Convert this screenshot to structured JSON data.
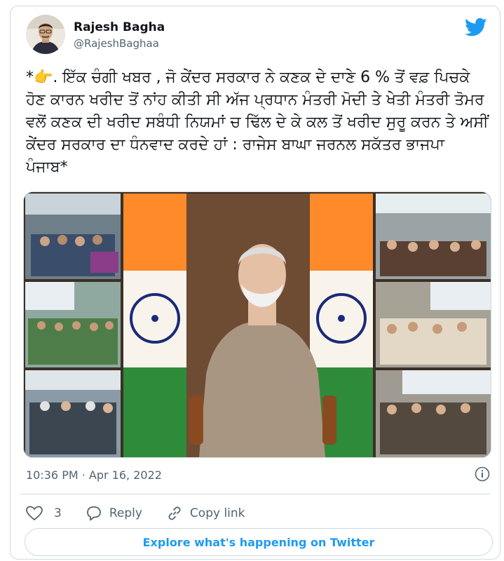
{
  "author": {
    "name": "Rajesh Bagha",
    "handle": "@RajeshBaghaa",
    "avatar_icon": "avatar-photo"
  },
  "brand": {
    "icon": "twitter-bird-icon",
    "color": "#1d9bf0"
  },
  "tweet": {
    "emoji_prefix": "*👉",
    "text": ". ਇੱਕ ਚੰਗੀ ਖਬਰ , ਜੋ ਕੇਂਦਰ ਸਰਕਾਰ ਨੇ ਕਣਕ ਦੇ ਦਾਣੇ 6 % ਤੋਂ ਵਫ਼ ਪਿਚਕੇ ਹੋਣ ਕਾਰਨ ਖਰੀਦ ਤੋਂ ਨਾਂਹ ਕੀਤੀ ਸੀ ਅੱਜ ਪ੍ਰਧਾਨ ਮੰਤਰੀ ਮੋਦੀ ਤੇ ਖੇਤੀ ਮੰਤਰੀ ਤੋਮਰ ਵਲੋਂ ਕਣਕ ਦੀ ਖਰੀਦ ਸਬੰਧੀ ਨਿਯਮਾਂ ਚ ਢਿੱਲ ਦੇ ਕੇ ਕਲ ਤੋਂ ਖਰੀਦ ਸੁਰੂ ਕਰਨ ਤੇ ਅਸੀਂ ਕੇਂਦਰ ਸਰਕਾਰ ਦਾ ਧੰਨਵਾਦ ਕਰਦੇ ਹਾਂ : ਰਾਜੇਸ ਬਾਘਾ ਜਰਨਲ ਸਕੱਤਰ ਭਾਜਪਾ ਪੰਜਾਬ*"
  },
  "media": {
    "description_icon": "video-conference-collage-image"
  },
  "meta": {
    "timestamp": "10:36 PM · Apr 16, 2022",
    "info_icon": "info-icon"
  },
  "actions": {
    "like_count": "3",
    "reply_label": "Reply",
    "copy_link_label": "Copy link"
  },
  "footer": {
    "explore_label": "Explore what's happening on Twitter"
  }
}
